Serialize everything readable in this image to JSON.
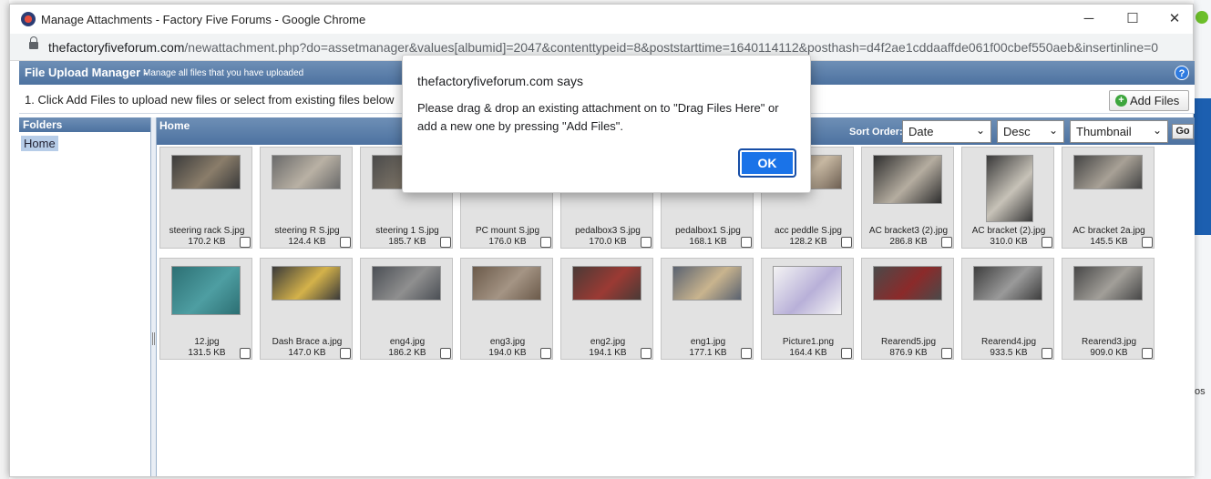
{
  "window": {
    "title": "Manage Attachments - Factory Five Forums - Google Chrome",
    "controls": {
      "minimize": "─",
      "maximize": "☐",
      "close": "✕"
    }
  },
  "address": {
    "host": "thefactoryfiveforum.com",
    "path": "/newattachment.php?do=assetmanager&values[albumid]=2047&contenttypeid=8&poststarttime=1640114112&posthash=d4f2ae1cddaaffde061f00cbef550aeb&insertinline=0"
  },
  "manager": {
    "title": "File Upload Manager",
    "separator": "-",
    "subtitle": "Manage all files that you have uploaded",
    "help_label": "?",
    "instruction": "1. Click Add Files to upload new files or select from existing files below",
    "add_files_label": "Add Files",
    "add_icon": "+"
  },
  "folders": {
    "header": "Folders",
    "items": [
      "Home"
    ]
  },
  "files": {
    "header": "Home",
    "sort_label": "Sort Order:",
    "sort_field": "Date",
    "sort_dir": "Desc",
    "view_mode": "Thumbnail",
    "go_label": "Go",
    "chevron": "⌄",
    "items": [
      {
        "name": "steering rack S.jpg",
        "size": "170.2 KB",
        "colors": [
          "#3b3b3b",
          "#8a7d6a"
        ]
      },
      {
        "name": "steering R S.jpg",
        "size": "124.4 KB",
        "colors": [
          "#6a6a6a",
          "#b9b1a4"
        ]
      },
      {
        "name": "steering 1 S.jpg",
        "size": "185.7 KB",
        "colors": [
          "#4a4a4a",
          "#7a7266"
        ]
      },
      {
        "name": "PC mount S.jpg",
        "size": "176.0 KB",
        "colors": [
          "#5a5a5a",
          "#9a8f80"
        ]
      },
      {
        "name": "pedalbox3 S.jpg",
        "size": "170.0 KB",
        "colors": [
          "#555555",
          "#8c7f6e"
        ]
      },
      {
        "name": "pedalbox1 S.jpg",
        "size": "168.1 KB",
        "colors": [
          "#5c5c5c",
          "#a49a8b"
        ]
      },
      {
        "name": "acc peddle S.jpg",
        "size": "128.2 KB",
        "colors": [
          "#6d5f52",
          "#c8b9a3"
        ]
      },
      {
        "name": "AC bracket3 (2).jpg",
        "size": "286.8 KB",
        "colors": [
          "#2f2f2f",
          "#b5ada0"
        ]
      },
      {
        "name": "AC bracket (2).jpg",
        "size": "310.0 KB",
        "colors": [
          "#3a3a3a",
          "#c7c2b8"
        ]
      },
      {
        "name": "AC bracket 2a.jpg",
        "size": "145.5 KB",
        "colors": [
          "#444444",
          "#a8a196"
        ]
      },
      {
        "name": "12.jpg",
        "size": "131.5 KB",
        "colors": [
          "#2c6f73",
          "#4e9ea2"
        ]
      },
      {
        "name": "Dash Brace a.jpg",
        "size": "147.0 KB",
        "colors": [
          "#3a3a3a",
          "#d4b24a"
        ]
      },
      {
        "name": "eng4.jpg",
        "size": "186.2 KB",
        "colors": [
          "#4b4f55",
          "#8f8f8f"
        ]
      },
      {
        "name": "eng3.jpg",
        "size": "194.0 KB",
        "colors": [
          "#6b5a4a",
          "#a49484"
        ]
      },
      {
        "name": "eng2.jpg",
        "size": "194.1 KB",
        "colors": [
          "#4a3a36",
          "#9b3a34"
        ]
      },
      {
        "name": "eng1.jpg",
        "size": "177.1 KB",
        "colors": [
          "#5a6270",
          "#c9b48e"
        ]
      },
      {
        "name": "Picture1.png",
        "size": "164.4 KB",
        "colors": [
          "#f4f4f4",
          "#b8b0d8"
        ]
      },
      {
        "name": "Rearend5.jpg",
        "size": "876.9 KB",
        "colors": [
          "#4a4a4a",
          "#8b2a2a"
        ]
      },
      {
        "name": "Rearend4.jpg",
        "size": "933.5 KB",
        "colors": [
          "#3e3e3e",
          "#9a9a9a"
        ]
      },
      {
        "name": "Rearend3.jpg",
        "size": "909.0 KB",
        "colors": [
          "#474747",
          "#a29f99"
        ]
      }
    ]
  },
  "dialog": {
    "title": "thefactoryfiveforum.com says",
    "message": "Please drag & drop an existing attachment on to \"Drag Files Here\" or add a new one by pressing \"Add Files\".",
    "ok_label": "OK"
  },
  "background": {
    "os_fragment": "os"
  }
}
